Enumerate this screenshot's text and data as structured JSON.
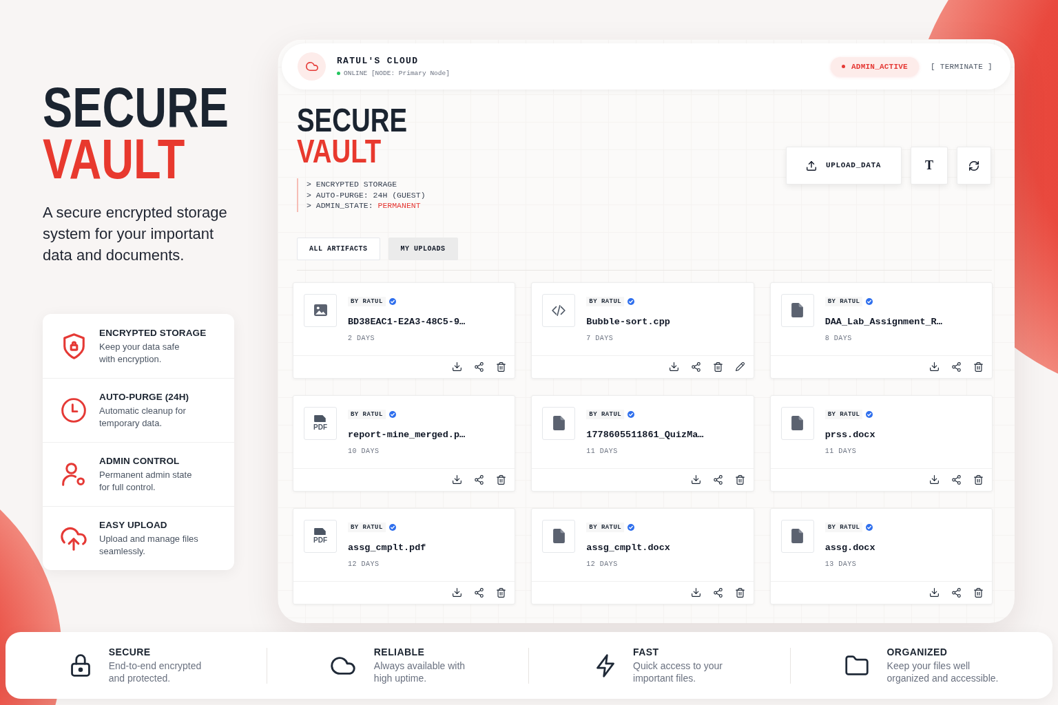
{
  "hero": {
    "title_top": "SECURE",
    "title_bottom": "VAULT",
    "description": "A secure encrypted storage system for your important data and documents."
  },
  "features": [
    {
      "title": "ENCRYPTED STORAGE",
      "description": "Keep your data safe\nwith encryption."
    },
    {
      "title": "AUTO-PURGE (24H)",
      "description": "Automatic cleanup for\ntemporary data."
    },
    {
      "title": "ADMIN CONTROL",
      "description": "Permanent admin state\nfor full control."
    },
    {
      "title": "EASY UPLOAD",
      "description": "Upload and manage files\nseamlessly."
    }
  ],
  "app": {
    "header": {
      "title": "RATUL'S CLOUD",
      "online": true,
      "status": "ONLINE [NODE: Primary Node]",
      "badge": "ADMIN_ACTIVE",
      "terminate": "[ TERMINATE ]"
    },
    "heading": {
      "top": "SECURE",
      "bottom": "VAULT"
    },
    "terminal": [
      {
        "text": "> ENCRYPTED STORAGE"
      },
      {
        "text": "> AUTO-PURGE: 24H (GUEST)"
      },
      {
        "text": "> ADMIN_STATE:",
        "value": "PERMANENT"
      }
    ],
    "toolbar": {
      "upload": "UPLOAD_DATA",
      "text_tool": "T"
    },
    "tabs": [
      {
        "label": "ALL ARTIFACTS",
        "selected": false
      },
      {
        "label": "MY UPLOADS",
        "selected": true
      }
    ],
    "files": [
      {
        "kind": "image",
        "uploader": "BY RATUL",
        "verified": true,
        "name": "BD38EAC1-E2A3-48C5-9…",
        "age": "2 DAYS",
        "editable": false
      },
      {
        "kind": "code",
        "uploader": "BY RATUL",
        "verified": true,
        "name": "Bubble-sort.cpp",
        "age": "7 DAYS",
        "editable": true
      },
      {
        "kind": "file",
        "uploader": "BY RATUL",
        "verified": true,
        "name": "DAA_Lab_Assignment_R…",
        "age": "8 DAYS",
        "editable": false
      },
      {
        "kind": "pdf",
        "thumb_label": "PDF",
        "uploader": "BY RATUL",
        "verified": true,
        "name": "report-mine_merged.p…",
        "age": "10 DAYS",
        "editable": false
      },
      {
        "kind": "file",
        "uploader": "BY RATUL",
        "verified": true,
        "name": "1778605511861_QuizMa…",
        "age": "11 DAYS",
        "editable": false
      },
      {
        "kind": "file",
        "uploader": "BY RATUL",
        "verified": true,
        "name": "prss.docx",
        "age": "11 DAYS",
        "editable": false
      },
      {
        "kind": "pdf",
        "thumb_label": "PDF",
        "uploader": "BY RATUL",
        "verified": true,
        "name": "assg_cmplt.pdf",
        "age": "12 DAYS",
        "editable": false
      },
      {
        "kind": "file",
        "uploader": "BY RATUL",
        "verified": true,
        "name": "assg_cmplt.docx",
        "age": "12 DAYS",
        "editable": false
      },
      {
        "kind": "file",
        "uploader": "BY RATUL",
        "verified": true,
        "name": "assg.docx",
        "age": "13 DAYS",
        "editable": false
      }
    ]
  },
  "highlights": [
    {
      "title": "SECURE",
      "description": "End-to-end encrypted\nand protected."
    },
    {
      "title": "RELIABLE",
      "description": "Always available with\nhigh uptime."
    },
    {
      "title": "FAST",
      "description": "Quick access to your\nimportant files."
    },
    {
      "title": "ORGANIZED",
      "description": "Keep your files well\norganized and accessible."
    }
  ]
}
